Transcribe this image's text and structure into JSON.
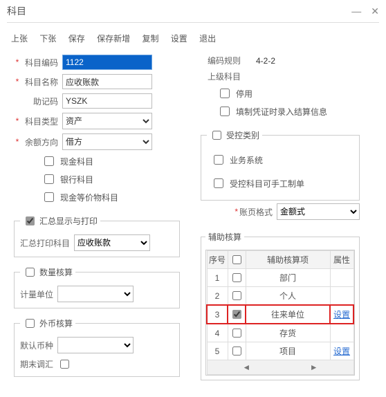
{
  "title": "科目",
  "menu": {
    "prev": "上张",
    "next": "下张",
    "save": "保存",
    "saveNew": "保存新增",
    "copy": "复制",
    "settings": "设置",
    "exit": "退出"
  },
  "left": {
    "code_label": "科目编码",
    "code_value": "1122",
    "name_label": "科目名称",
    "name_value": "应收账款",
    "mnemonic_label": "助记码",
    "mnemonic_value": "YSZK",
    "type_label": "科目类型",
    "type_value": "资产",
    "dir_label": "余额方向",
    "dir_value": "借方",
    "chk_cash": "现金科目",
    "chk_bank": "银行科目",
    "chk_cashEq": "现金等价物科目",
    "grp_summary": "汇总显示与打印",
    "summary_label": "汇总打印科目",
    "summary_value": "应收账款",
    "grp_qty": "数量核算",
    "qty_label": "计量单位",
    "grp_fx": "外币核算",
    "fx_label": "默认币种",
    "fx_eop": "期末调汇"
  },
  "right": {
    "rule_label": "编码规则",
    "rule_value": "4-2-2",
    "parent_label": "上级科目",
    "chk_disable": "停用",
    "chk_enterAux": "填制凭证时录入结算信息",
    "grp_ctrl": "受控类别",
    "chk_biz": "业务系统",
    "chk_manual": "受控科目可手工制单",
    "acctfmt_label": "账页格式",
    "acctfmt_value": "金额式",
    "grp_aux": "辅助核算",
    "grid": {
      "cols": {
        "seq": "序号",
        "item": "辅助核算项",
        "attr": "属性"
      },
      "rows": [
        {
          "seq": "1",
          "item": "部门",
          "checked": false,
          "link": ""
        },
        {
          "seq": "2",
          "item": "个人",
          "checked": false,
          "link": ""
        },
        {
          "seq": "3",
          "item": "往来单位",
          "checked": true,
          "link": "设置",
          "sel": true
        },
        {
          "seq": "4",
          "item": "存货",
          "checked": false,
          "link": ""
        },
        {
          "seq": "5",
          "item": "项目",
          "checked": false,
          "link": "设置"
        }
      ]
    }
  },
  "icons": {
    "min": "—",
    "close": "✕",
    "left": "◄",
    "right": "►"
  }
}
